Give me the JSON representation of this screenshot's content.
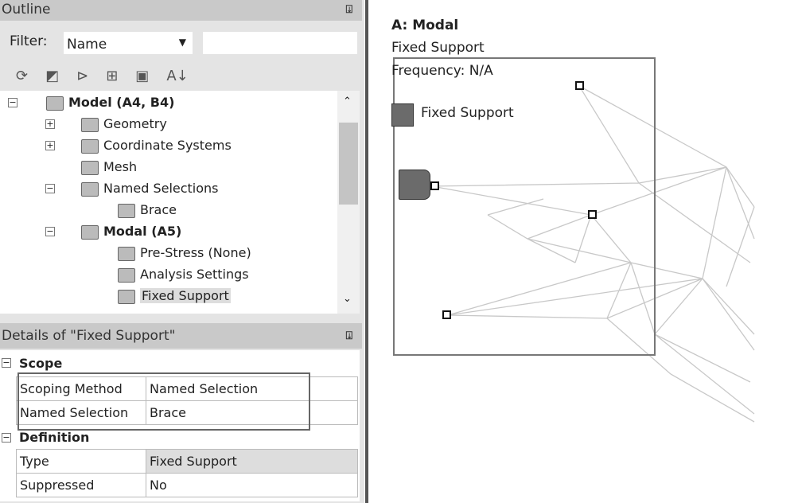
{
  "outline": {
    "title": "Outline",
    "filter_label": "Filter:",
    "filter_value": "Name",
    "search_value": "",
    "tree": [
      {
        "label": "Model (A4, B4)",
        "bold": true,
        "level": 0
      },
      {
        "label": "Geometry",
        "level": 1
      },
      {
        "label": "Coordinate Systems",
        "level": 1
      },
      {
        "label": "Mesh",
        "level": 1
      },
      {
        "label": "Named Selections",
        "level": 1
      },
      {
        "label": "Brace",
        "level": 2
      },
      {
        "label": "Modal (A5)",
        "bold": true,
        "level": 1
      },
      {
        "label": "Pre-Stress (None)",
        "level": 2
      },
      {
        "label": "Analysis Settings",
        "level": 2
      },
      {
        "label": "Fixed Support",
        "level": 2,
        "selected": true
      }
    ]
  },
  "details": {
    "title": "Details of \"Fixed Support\"",
    "groups": [
      {
        "name": "Scope",
        "rows": [
          [
            "Scoping Method",
            "Named Selection"
          ],
          [
            "Named Selection",
            "Brace"
          ]
        ]
      },
      {
        "name": "Definition",
        "rows": [
          [
            "Type",
            "Fixed Support"
          ],
          [
            "Suppressed",
            "No"
          ]
        ]
      }
    ]
  },
  "viewport": {
    "title": "A: Modal",
    "subtitle": "Fixed Support",
    "frequency": "Frequency: N/A",
    "legend_label": "Fixed Support",
    "legend_color": "#6b6b6b"
  }
}
